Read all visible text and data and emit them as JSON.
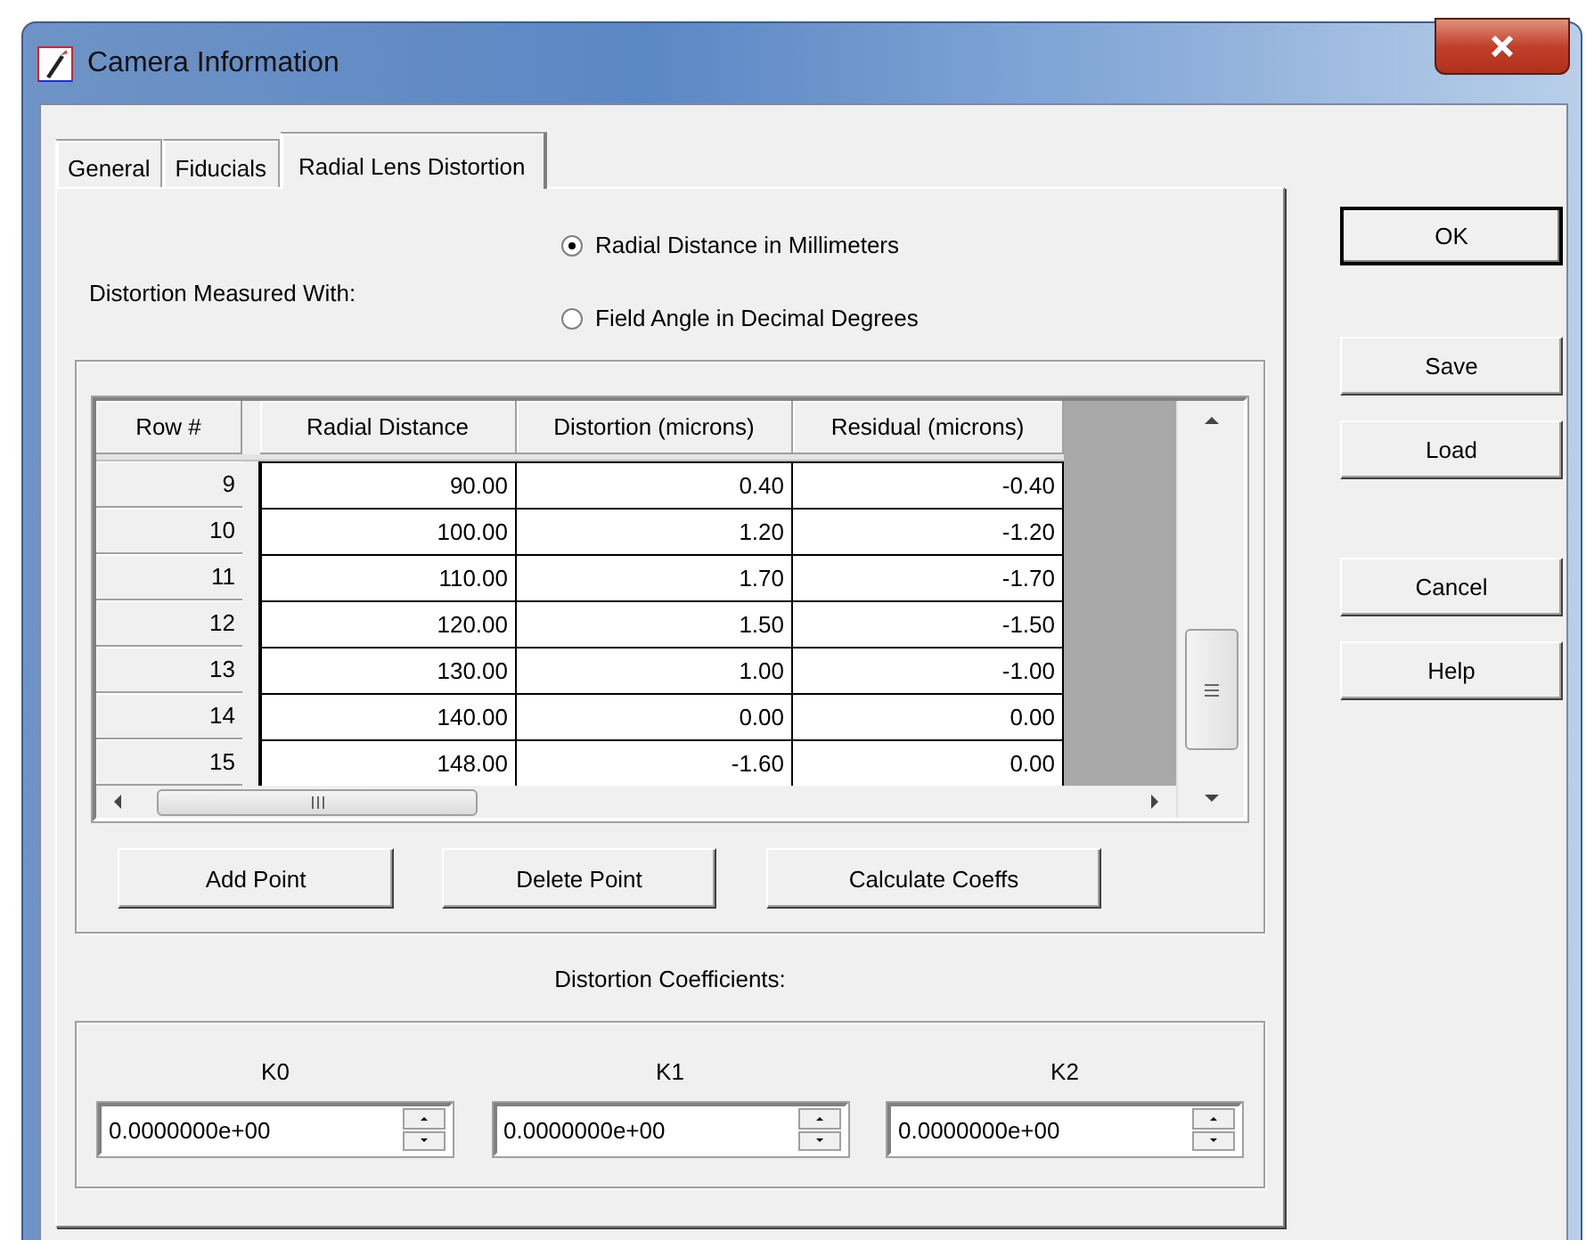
{
  "window": {
    "title": "Camera Information"
  },
  "tabs": [
    {
      "label": "General",
      "selected": false
    },
    {
      "label": "Fiducials",
      "selected": false
    },
    {
      "label": "Radial Lens Distortion",
      "selected": true
    }
  ],
  "distortion_measured_with": {
    "label": "Distortion Measured With:",
    "options": [
      {
        "label": "Radial Distance in Millimeters",
        "selected": true
      },
      {
        "label": "Field Angle in Decimal Degrees",
        "selected": false
      }
    ]
  },
  "grid": {
    "columns": [
      "Row #",
      "Radial Distance",
      "Distortion (microns)",
      "Residual (microns)"
    ],
    "rows": [
      {
        "row": "9",
        "cells": [
          "90.00",
          "0.40",
          "-0.40"
        ]
      },
      {
        "row": "10",
        "cells": [
          "100.00",
          "1.20",
          "-1.20"
        ]
      },
      {
        "row": "11",
        "cells": [
          "110.00",
          "1.70",
          "-1.70"
        ]
      },
      {
        "row": "12",
        "cells": [
          "120.00",
          "1.50",
          "-1.50"
        ]
      },
      {
        "row": "13",
        "cells": [
          "130.00",
          "1.00",
          "-1.00"
        ]
      },
      {
        "row": "14",
        "cells": [
          "140.00",
          "0.00",
          "0.00"
        ]
      },
      {
        "row": "15",
        "cells": [
          "148.00",
          "-1.60",
          "0.00"
        ]
      }
    ]
  },
  "grid_buttons": [
    "Add Point",
    "Delete Point",
    "Calculate Coeffs"
  ],
  "coefficients": {
    "title": "Distortion Coefficients:",
    "fields": [
      {
        "label": "K0",
        "value": "0.0000000e+00"
      },
      {
        "label": "K1",
        "value": "0.0000000e+00"
      },
      {
        "label": "K2",
        "value": "0.0000000e+00"
      }
    ]
  },
  "dialog_buttons": [
    {
      "label": "OK",
      "default": true
    },
    {
      "label": "Save",
      "default": false
    },
    {
      "label": "Load",
      "default": false
    },
    {
      "label": "Cancel",
      "default": false
    },
    {
      "label": "Help",
      "default": false
    }
  ]
}
